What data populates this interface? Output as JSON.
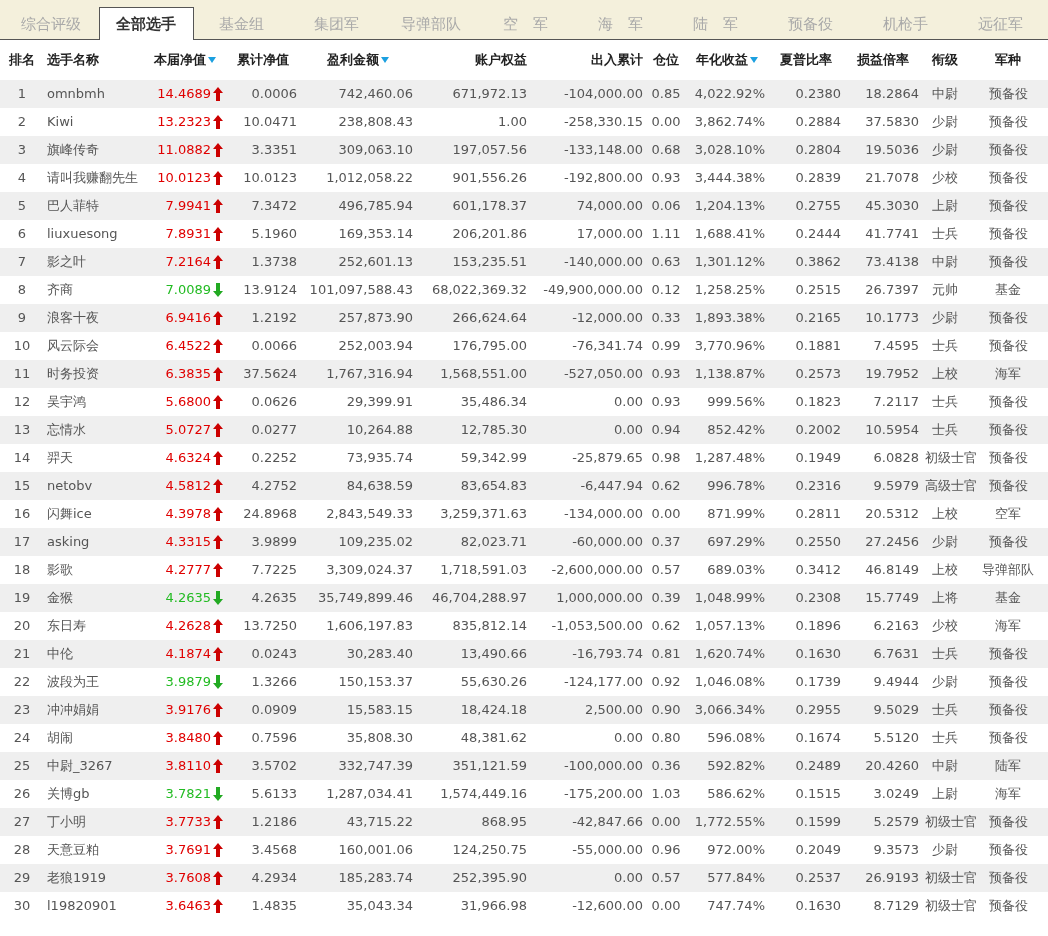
{
  "tabs": [
    {
      "label": "综合评级",
      "selected": false
    },
    {
      "label": "全部选手",
      "selected": true
    },
    {
      "label": "基金组",
      "selected": false
    },
    {
      "label": "集团军",
      "selected": false
    },
    {
      "label": "导弹部队",
      "selected": false
    },
    {
      "label": "空　军",
      "selected": false
    },
    {
      "label": "海　军",
      "selected": false
    },
    {
      "label": "陆　军",
      "selected": false
    },
    {
      "label": "预备役",
      "selected": false
    },
    {
      "label": "机枪手",
      "selected": false
    },
    {
      "label": "远征军",
      "selected": false
    }
  ],
  "table": {
    "columns": [
      {
        "label": "排名",
        "sort_indicator": false
      },
      {
        "label": "选手名称",
        "sort_indicator": false
      },
      {
        "label": "本届净值",
        "sort_indicator": true
      },
      {
        "label": "累计净值",
        "sort_indicator": false
      },
      {
        "label": "盈利金额",
        "sort_indicator": true
      },
      {
        "label": "账户权益",
        "sort_indicator": false
      },
      {
        "label": "出入累计",
        "sort_indicator": false
      },
      {
        "label": "仓位",
        "sort_indicator": false
      },
      {
        "label": "年化收益",
        "sort_indicator": true
      },
      {
        "label": "夏普比率",
        "sort_indicator": false
      },
      {
        "label": "损益倍率",
        "sort_indicator": false
      },
      {
        "label": "衔级",
        "sort_indicator": false
      },
      {
        "label": "军种",
        "sort_indicator": false
      }
    ],
    "rows": [
      {
        "kind": "rise",
        "cells": [
          "1",
          "omnbmh",
          "14.4689",
          "0.0006",
          "742,460.06",
          "671,972.13",
          "-104,000.00",
          "0.85",
          "4,022.92%",
          "0.2380",
          "18.2864",
          "中尉",
          "预备役"
        ]
      },
      {
        "kind": "rise",
        "cells": [
          "2",
          "Kiwi",
          "13.2323",
          "10.0471",
          "238,808.43",
          "1.00",
          "-258,330.15",
          "0.00",
          "3,862.74%",
          "0.2884",
          "37.5830",
          "少尉",
          "预备役"
        ]
      },
      {
        "kind": "rise",
        "cells": [
          "3",
          "旗峰传奇",
          "11.0882",
          "3.3351",
          "309,063.10",
          "197,057.56",
          "-133,148.00",
          "0.68",
          "3,028.10%",
          "0.2804",
          "19.5036",
          "少尉",
          "预备役"
        ]
      },
      {
        "kind": "rise",
        "cells": [
          "4",
          "请叫我赚翻先生",
          "10.0123",
          "10.0123",
          "1,012,058.22",
          "901,556.26",
          "-192,800.00",
          "0.93",
          "3,444.38%",
          "0.2839",
          "21.7078",
          "少校",
          "预备役"
        ]
      },
      {
        "kind": "rise",
        "cells": [
          "5",
          "巴人菲特",
          "7.9941",
          "7.3472",
          "496,785.94",
          "601,178.37",
          "74,000.00",
          "0.06",
          "1,204.13%",
          "0.2755",
          "45.3030",
          "上尉",
          "预备役"
        ]
      },
      {
        "kind": "rise",
        "cells": [
          "6",
          "liuxuesong",
          "7.8931",
          "5.1960",
          "169,353.14",
          "206,201.86",
          "17,000.00",
          "1.11",
          "1,688.41%",
          "0.2444",
          "41.7741",
          "士兵",
          "预备役"
        ]
      },
      {
        "kind": "rise",
        "cells": [
          "7",
          "影之叶",
          "7.2164",
          "1.3738",
          "252,601.13",
          "153,235.51",
          "-140,000.00",
          "0.63",
          "1,301.12%",
          "0.3862",
          "73.4138",
          "中尉",
          "预备役"
        ]
      },
      {
        "kind": "fall",
        "cells": [
          "8",
          "齐商",
          "7.0089",
          "13.9124",
          "101,097,588.43",
          "68,022,369.32",
          "-49,900,000.00",
          "0.12",
          "1,258.25%",
          "0.2515",
          "26.7397",
          "元帅",
          "基金"
        ]
      },
      {
        "kind": "rise",
        "cells": [
          "9",
          "浪客十夜",
          "6.9416",
          "1.2192",
          "257,873.90",
          "266,624.64",
          "-12,000.00",
          "0.33",
          "1,893.38%",
          "0.2165",
          "10.1773",
          "少尉",
          "预备役"
        ]
      },
      {
        "kind": "rise",
        "cells": [
          "10",
          "风云际会",
          "6.4522",
          "0.0066",
          "252,003.94",
          "176,795.00",
          "-76,341.74",
          "0.99",
          "3,770.96%",
          "0.1881",
          "7.4595",
          "士兵",
          "预备役"
        ]
      },
      {
        "kind": "rise",
        "cells": [
          "11",
          "时务投资",
          "6.3835",
          "37.5624",
          "1,767,316.94",
          "1,568,551.00",
          "-527,050.00",
          "0.93",
          "1,138.87%",
          "0.2573",
          "19.7952",
          "上校",
          "海军"
        ]
      },
      {
        "kind": "rise",
        "cells": [
          "12",
          "吴宇鸿",
          "5.6800",
          "0.0626",
          "29,399.91",
          "35,486.34",
          "0.00",
          "0.93",
          "999.56%",
          "0.1823",
          "7.2117",
          "士兵",
          "预备役"
        ]
      },
      {
        "kind": "rise",
        "cells": [
          "13",
          "忘情水",
          "5.0727",
          "0.0277",
          "10,264.88",
          "12,785.30",
          "0.00",
          "0.94",
          "852.42%",
          "0.2002",
          "10.5954",
          "士兵",
          "预备役"
        ]
      },
      {
        "kind": "rise",
        "cells": [
          "14",
          "羿天",
          "4.6324",
          "0.2252",
          "73,935.74",
          "59,342.99",
          "-25,879.65",
          "0.98",
          "1,287.48%",
          "0.1949",
          "6.0828",
          "初级士官",
          "预备役"
        ]
      },
      {
        "kind": "rise",
        "cells": [
          "15",
          "netobv",
          "4.5812",
          "4.2752",
          "84,638.59",
          "83,654.83",
          "-6,447.94",
          "0.62",
          "996.78%",
          "0.2316",
          "9.5979",
          "高级士官",
          "预备役"
        ]
      },
      {
        "kind": "rise",
        "cells": [
          "16",
          "闪舞ice",
          "4.3978",
          "24.8968",
          "2,843,549.33",
          "3,259,371.63",
          "-134,000.00",
          "0.00",
          "871.99%",
          "0.2811",
          "20.5312",
          "上校",
          "空军"
        ]
      },
      {
        "kind": "rise",
        "cells": [
          "17",
          "asking",
          "4.3315",
          "3.9899",
          "109,235.02",
          "82,023.71",
          "-60,000.00",
          "0.37",
          "697.29%",
          "0.2550",
          "27.2456",
          "少尉",
          "预备役"
        ]
      },
      {
        "kind": "rise",
        "cells": [
          "18",
          "影歌",
          "4.2777",
          "7.7225",
          "3,309,024.37",
          "1,718,591.03",
          "-2,600,000.00",
          "0.57",
          "689.03%",
          "0.3412",
          "46.8149",
          "上校",
          "导弹部队"
        ]
      },
      {
        "kind": "fall",
        "cells": [
          "19",
          "金猴",
          "4.2635",
          "4.2635",
          "35,749,899.46",
          "46,704,288.97",
          "1,000,000.00",
          "0.39",
          "1,048.99%",
          "0.2308",
          "15.7749",
          "上将",
          "基金"
        ]
      },
      {
        "kind": "rise",
        "cells": [
          "20",
          "东日寿",
          "4.2628",
          "13.7250",
          "1,606,197.83",
          "835,812.14",
          "-1,053,500.00",
          "0.62",
          "1,057.13%",
          "0.1896",
          "6.2163",
          "少校",
          "海军"
        ]
      },
      {
        "kind": "rise",
        "cells": [
          "21",
          "中伦",
          "4.1874",
          "0.0243",
          "30,283.40",
          "13,490.66",
          "-16,793.74",
          "0.81",
          "1,620.74%",
          "0.1630",
          "6.7631",
          "士兵",
          "预备役"
        ]
      },
      {
        "kind": "fall",
        "cells": [
          "22",
          "波段为王",
          "3.9879",
          "1.3266",
          "150,153.37",
          "55,630.26",
          "-124,177.00",
          "0.92",
          "1,046.08%",
          "0.1739",
          "9.4944",
          "少尉",
          "预备役"
        ]
      },
      {
        "kind": "rise",
        "cells": [
          "23",
          "冲冲娟娟",
          "3.9176",
          "0.0909",
          "15,583.15",
          "18,424.18",
          "2,500.00",
          "0.90",
          "3,066.34%",
          "0.2955",
          "9.5029",
          "士兵",
          "预备役"
        ]
      },
      {
        "kind": "rise",
        "cells": [
          "24",
          "胡闹",
          "3.8480",
          "0.7596",
          "35,808.30",
          "48,381.62",
          "0.00",
          "0.80",
          "596.08%",
          "0.1674",
          "5.5120",
          "士兵",
          "预备役"
        ]
      },
      {
        "kind": "rise",
        "cells": [
          "25",
          "中尉_3267",
          "3.8110",
          "3.5702",
          "332,747.39",
          "351,121.59",
          "-100,000.00",
          "0.36",
          "592.82%",
          "0.2489",
          "20.4260",
          "中尉",
          "陆军"
        ]
      },
      {
        "kind": "fall",
        "cells": [
          "26",
          "关博gb",
          "3.7821",
          "5.6133",
          "1,287,034.41",
          "1,574,449.16",
          "-175,200.00",
          "1.03",
          "586.62%",
          "0.1515",
          "3.0249",
          "上尉",
          "海军"
        ]
      },
      {
        "kind": "rise",
        "cells": [
          "27",
          "丁小明",
          "3.7733",
          "1.2186",
          "43,715.22",
          "868.95",
          "-42,847.66",
          "0.00",
          "1,772.55%",
          "0.1599",
          "5.2579",
          "初级士官",
          "预备役"
        ]
      },
      {
        "kind": "rise",
        "cells": [
          "28",
          "天意豆粕",
          "3.7691",
          "3.4568",
          "160,001.06",
          "124,250.75",
          "-55,000.00",
          "0.96",
          "972.00%",
          "0.2049",
          "9.3573",
          "少尉",
          "预备役"
        ]
      },
      {
        "kind": "rise",
        "cells": [
          "29",
          "老狼1919",
          "3.7608",
          "4.2934",
          "185,283.74",
          "252,395.90",
          "0.00",
          "0.57",
          "577.84%",
          "0.2537",
          "26.9193",
          "初级士官",
          "预备役"
        ]
      },
      {
        "kind": "rise",
        "cells": [
          "30",
          "l19820901",
          "3.6463",
          "1.4835",
          "35,043.34",
          "31,966.98",
          "-12,600.00",
          "0.00",
          "747.74%",
          "0.1630",
          "8.7129",
          "初级士官",
          "预备役"
        ]
      }
    ]
  }
}
